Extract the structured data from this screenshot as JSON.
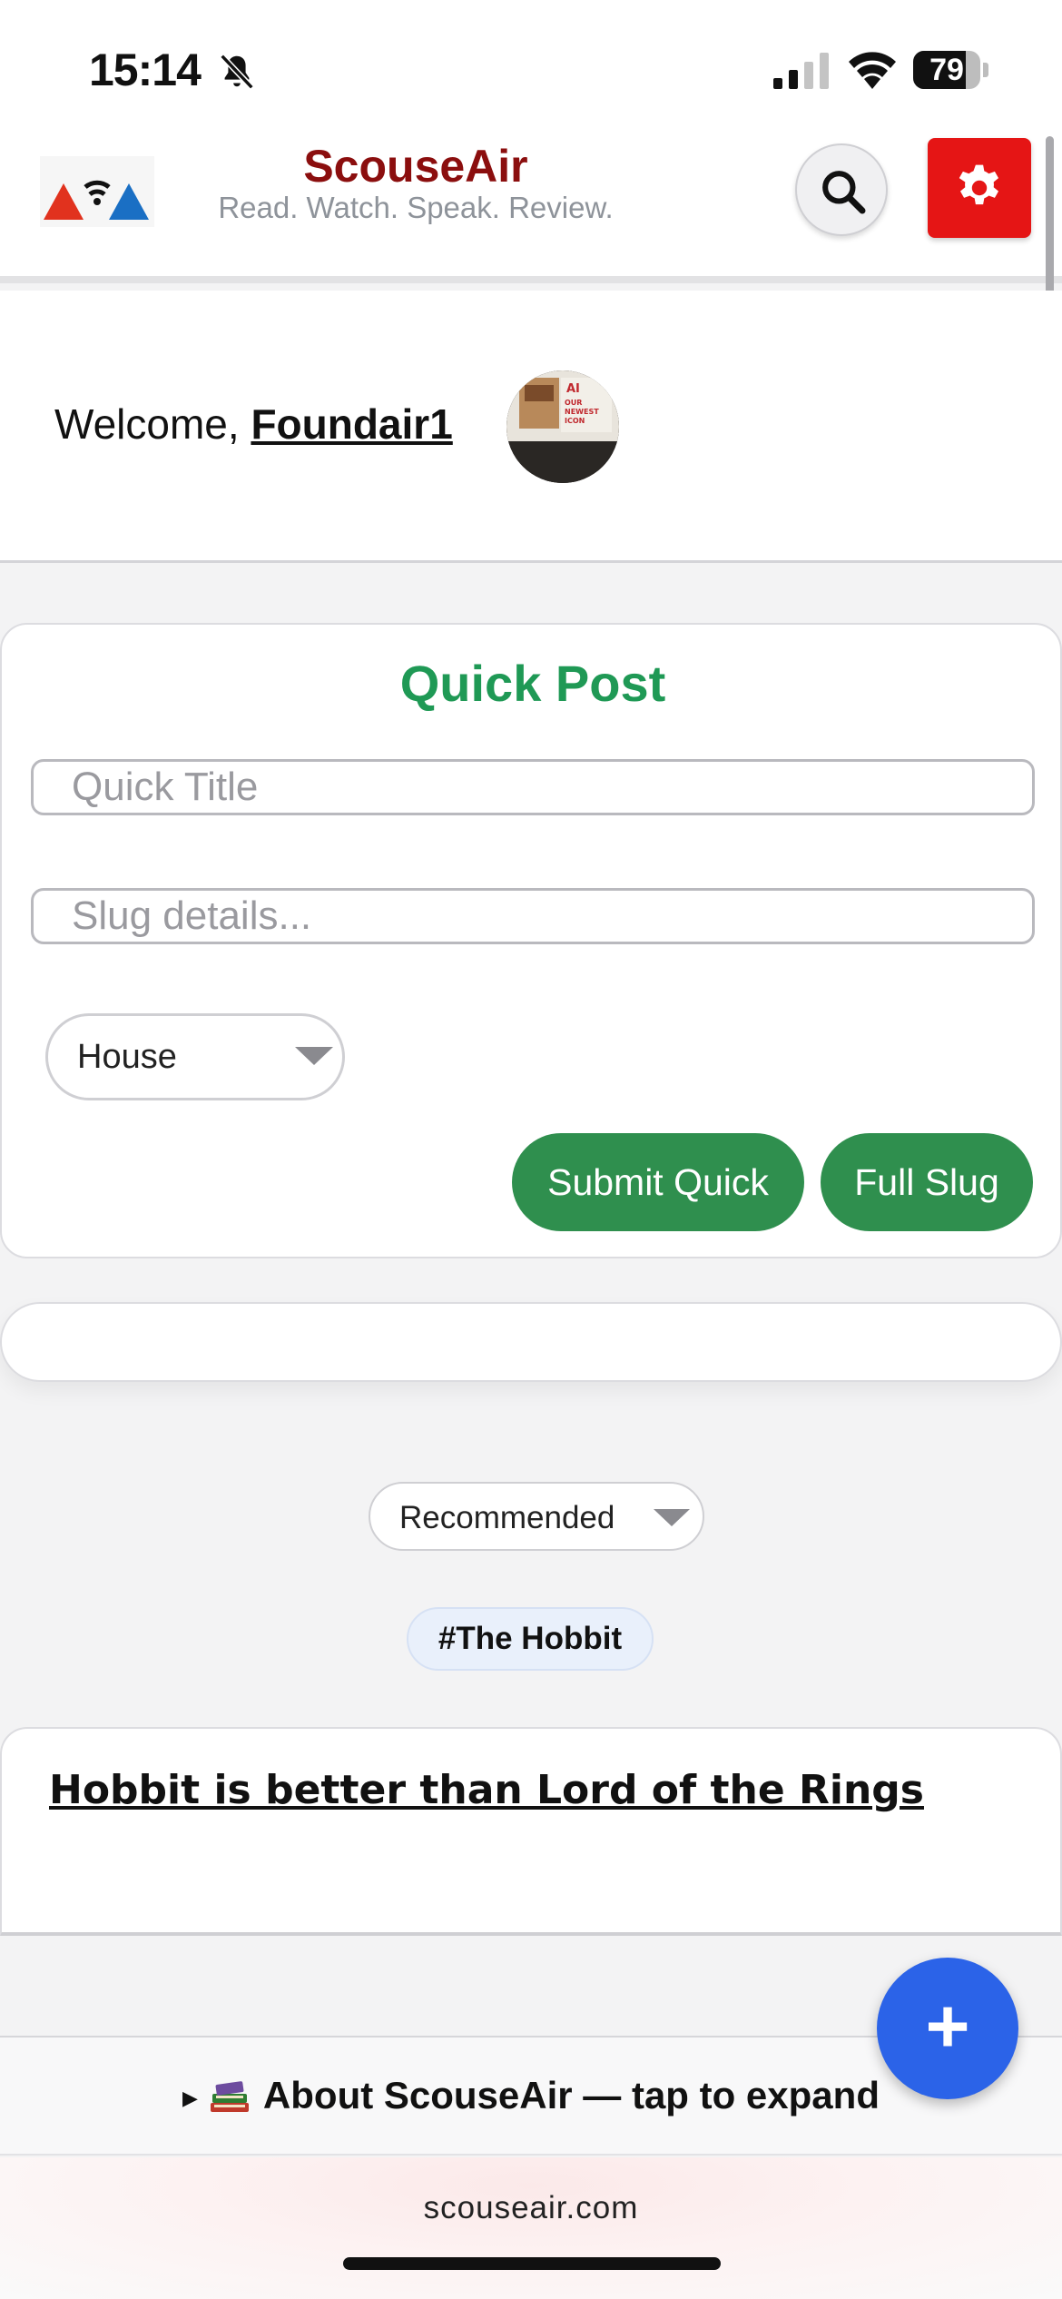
{
  "status_bar": {
    "time": "15:14",
    "battery_percent": "79",
    "battery_level": 0.79,
    "icons": [
      "bell-slash-icon",
      "cellular-signal-icon",
      "wifi-icon",
      "battery-icon"
    ]
  },
  "header": {
    "brand_name": "ScouseAir",
    "tagline": "Read. Watch. Speak. Review.",
    "icons": [
      "logo-icon",
      "search-icon",
      "gear-icon"
    ],
    "colors": {
      "brand": "#8b0e0e",
      "settings_button": "#e51515"
    }
  },
  "welcome": {
    "greeting": "Welcome, ",
    "username": "Foundair1",
    "avatar_text": "OUR NEWEST ICON"
  },
  "quick_post": {
    "title": "Quick Post",
    "title_placeholder": "Quick Title",
    "details_placeholder": "Slug details...",
    "category_selected": "House",
    "submit_label": "Submit Quick",
    "full_label": "Full Slug",
    "colors": {
      "title": "#1f9955",
      "buttons": "#2f8f4e"
    }
  },
  "feed": {
    "sort_selected": "Recommended",
    "tag": "#The Hobbit",
    "posts": [
      {
        "title": "Hobbit is better than Lord of the Rings"
      }
    ]
  },
  "about": {
    "text": "About ScouseAir — tap to expand",
    "icon": "books-icon"
  },
  "footer": {
    "domain": "scouseair.com"
  },
  "fab": {
    "label": "+",
    "color": "#2b63e8"
  }
}
